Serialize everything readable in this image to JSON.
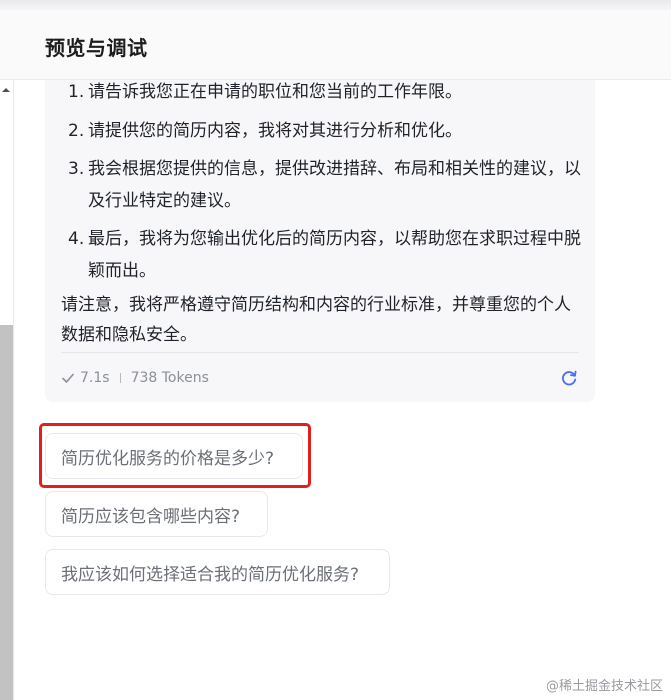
{
  "header": {
    "title": "预览与调试"
  },
  "message": {
    "items": [
      {
        "num": "1.",
        "text": "请告诉我您正在申请的职位和您当前的工作年限。"
      },
      {
        "num": "2.",
        "text": "请提供您的简历内容，我将对其进行分析和优化。"
      },
      {
        "num": "3.",
        "text": "我会根据您提供的信息，提供改进措辞、布局和相关性的建议，以及行业特定的建议。"
      },
      {
        "num": "4.",
        "text": "最后，我将为您输出优化后的简历内容，以帮助您在求职过程中脱颖而出。"
      }
    ],
    "note": "请注意，我将严格遵守简历结构和内容的行业标准，并尊重您的个人数据和隐私安全。",
    "meta": {
      "duration": "7.1s",
      "tokens": "738 Tokens"
    }
  },
  "suggestions": [
    {
      "label": "简历优化服务的价格是多少?"
    },
    {
      "label": "简历应该包含哪些内容?"
    },
    {
      "label": "我应该如何选择适合我的简历优化服务?"
    }
  ],
  "watermark": "@稀土掘金技术社区",
  "colors": {
    "highlight": "#e0201c",
    "accent": "#4a6cf7",
    "card_bg": "#f7f7f9"
  },
  "icons": {
    "check": "check-icon",
    "refresh": "refresh-icon",
    "scroll_up": "scroll-up-arrow-icon"
  }
}
